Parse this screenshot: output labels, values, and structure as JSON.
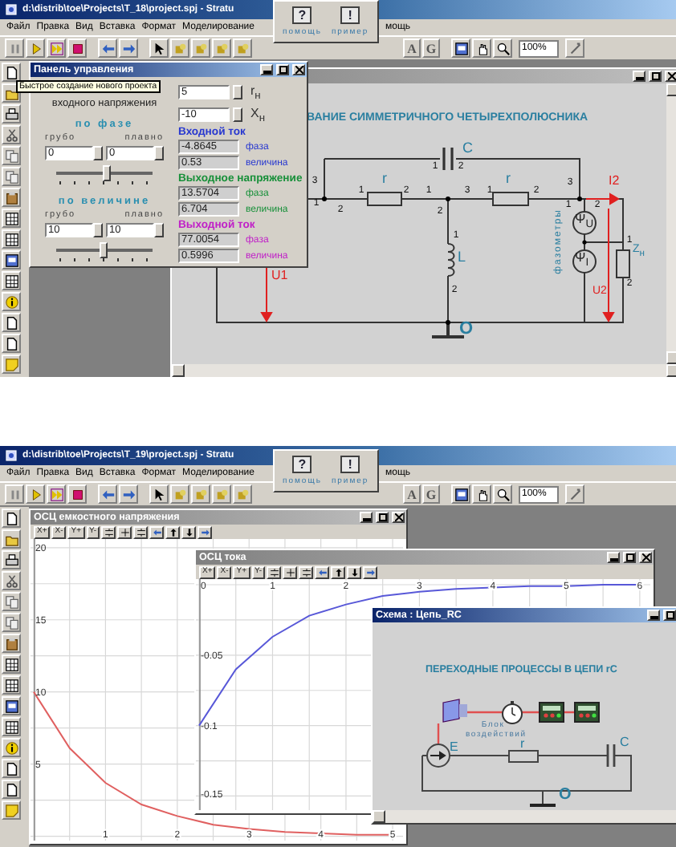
{
  "screens": [
    {
      "title": "d:\\distrib\\toe\\Projects\\T_18\\project.spj - Stratu",
      "menu": [
        "Файл",
        "Правка",
        "Вид",
        "Вставка",
        "Формат",
        "Моделирование"
      ],
      "menu_tail": "мощь",
      "help": [
        {
          "glyph": "?",
          "label": "помощь"
        },
        {
          "glyph": "!",
          "label": "пример"
        }
      ],
      "toolbar_letters": [
        "A",
        "G"
      ],
      "zoom": "100%",
      "tooltip": "Быстрое создание нового проекта",
      "windows": [
        {
          "kind": "schematic",
          "active": false,
          "heading": "ВАНИЕ СИММЕТРИЧНОГО ЧЕТЫРЕХПОЛЮСНИКА",
          "labels": [
            "C",
            "r",
            "r",
            "L",
            "I2",
            "U1",
            "U2",
            "O",
            "Ψ$_{U}$",
            "Ψ$_{I}$",
            "Z$_{н}$"
          ],
          "side_label": "фазометры",
          "pins": [
            "1",
            "2",
            "1",
            "2",
            "1",
            "3",
            "1",
            "2",
            "3",
            "1",
            "2",
            "2",
            "1",
            "2",
            "1",
            "2",
            "3",
            "1",
            "2"
          ]
        },
        {
          "kind": "control_panel",
          "active": true,
          "title": "Панель управления",
          "heading": "входного напряжения",
          "groups": [
            {
              "label": "по фазе",
              "coarse": "грубо",
              "fine": "плавно",
              "values": [
                "0",
                "0"
              ],
              "level": 0.52
            },
            {
              "label": "по величине",
              "coarse": "грубо",
              "fine": "плавно",
              "values": [
                "10",
                "10"
              ],
              "level": 0.48
            }
          ],
          "params": [
            {
              "value": "5",
              "symbol": "r$_{н}$"
            },
            {
              "value": "-10",
              "symbol": "X$_{н}$"
            }
          ],
          "readouts": [
            {
              "title": "Входной ток",
              "color": "#2838d0",
              "rows": [
                {
                  "value": "-4.8645",
                  "label": "фаза"
                },
                {
                  "value": "0.53",
                  "label": "величина"
                }
              ]
            },
            {
              "title": "Выходное напряжение",
              "color": "#18903a",
              "rows": [
                {
                  "value": "13.5704",
                  "label": "фаза"
                },
                {
                  "value": "6.704",
                  "label": "величина"
                }
              ]
            },
            {
              "title": "Выходной ток",
              "color": "#c020c8",
              "rows": [
                {
                  "value": "77.0054",
                  "label": "фаза"
                },
                {
                  "value": "0.5996",
                  "label": "величина"
                }
              ]
            }
          ]
        }
      ]
    },
    {
      "title": "d:\\distrib\\toe\\Projects\\T_19\\project.spj - Stratu",
      "menu": [
        "Файл",
        "Правка",
        "Вид",
        "Вставка",
        "Формат",
        "Моделирование"
      ],
      "menu_tail": "мощь",
      "help": [
        {
          "glyph": "?",
          "label": "помощь"
        },
        {
          "glyph": "!",
          "label": "пример"
        }
      ],
      "toolbar_letters": [
        "A",
        "G"
      ],
      "zoom": "100%",
      "windows": [
        {
          "kind": "oscilloscope",
          "active": false,
          "title": "ОСЦ емкостного напряжения",
          "buttons": [
            "X+",
            "X-",
            "Y+",
            "Y-"
          ],
          "chart_data": {
            "type": "line",
            "x": [
              0,
              0.5,
              1,
              1.5,
              2,
              2.5,
              3,
              3.5,
              4,
              4.5,
              5
            ],
            "series": [
              {
                "color": "#e06060",
                "values": [
                  10,
                  6.1,
                  3.7,
                  2.2,
                  1.4,
                  0.8,
                  0.5,
                  0.3,
                  0.2,
                  0.1,
                  0.1
                ]
              }
            ],
            "xlim": [
              0,
              5.1
            ],
            "ylim": [
              -0.3,
              20.6
            ],
            "xticks": [
              1,
              2,
              3,
              4,
              5
            ],
            "yticks": [
              5,
              10,
              15,
              20
            ],
            "grid": true
          }
        },
        {
          "kind": "oscilloscope",
          "active": false,
          "title": "ОСЦ тока",
          "buttons": [
            "X+",
            "X-",
            "Y+",
            "Y-"
          ],
          "chart_data": {
            "type": "line",
            "x": [
              0,
              0.5,
              1,
              1.5,
              2,
              2.5,
              3,
              3.5,
              4,
              4.5,
              5,
              5.5,
              6
            ],
            "series": [
              {
                "color": "#5858d8",
                "values": [
                  -0.1,
                  -0.06,
                  -0.037,
                  -0.022,
                  -0.014,
                  -0.008,
                  -0.005,
                  -0.003,
                  -0.002,
                  -0.001,
                  -0.001,
                  0,
                  0
                ]
              }
            ],
            "xlim": [
              0,
              6.1
            ],
            "ylim": [
              -0.16,
              0.004
            ],
            "xticks": [
              1,
              2,
              3,
              4,
              5,
              6
            ],
            "yticks": [
              0,
              -0.05,
              -0.1,
              -0.15
            ],
            "grid": true
          }
        },
        {
          "kind": "rc_scheme",
          "active": true,
          "title": "Схема : Цепь_RC",
          "heading": "ПЕРЕХОДНЫЕ ПРОЦЕССЫ  В ЦЕПИ rC",
          "block_label": "Блок воздействий",
          "labels": [
            "E",
            "r",
            "C",
            "O"
          ]
        }
      ]
    }
  ]
}
